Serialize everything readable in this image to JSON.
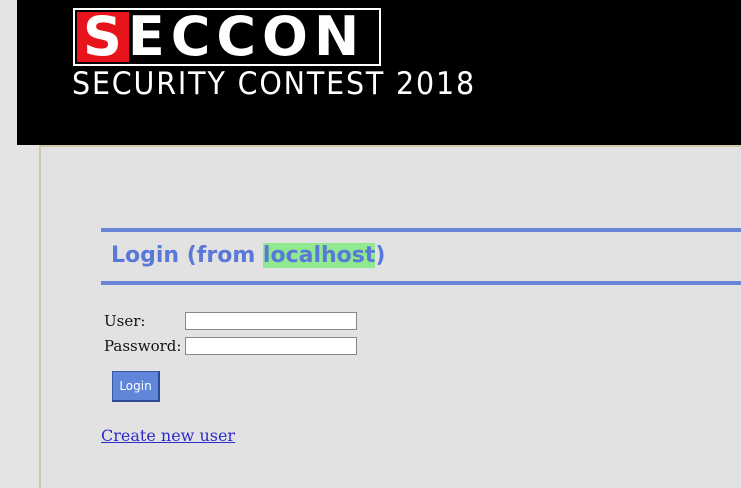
{
  "header": {
    "logo_text": "SECCON",
    "subtitle": "SECURITY CONTEST 2018"
  },
  "login": {
    "heading_prefix": "Login (from ",
    "host": "localhost",
    "heading_suffix": ")",
    "user_label": "User:",
    "user_value": "",
    "password_label": "Password:",
    "password_value": "",
    "button_label": "Login"
  },
  "links": {
    "create_user": "Create new user"
  },
  "colors": {
    "header_bg": "#000000",
    "logo_red": "#e8141b",
    "heading_blue": "#5a78d8",
    "host_highlight": "#90e890",
    "button_blue": "#5f86d9",
    "link_blue": "#2c2ccc"
  }
}
